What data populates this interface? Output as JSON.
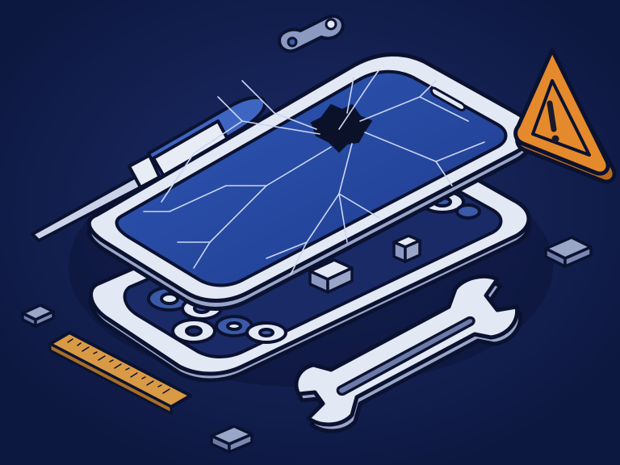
{
  "scene": {
    "subject": "broken-smartphone-repair",
    "colors": {
      "background": "#0f1b45",
      "background_glow": "#1a2a66",
      "outline": "#0b1230",
      "frame_light": "#e3e8f5",
      "frame_shadow": "#9aa6c8",
      "screen_blue": "#2a4ea8",
      "screen_blue_dark": "#1c3680",
      "crack": "#c9d6f2",
      "hole": "#0a1128",
      "internal_blue": "#3a5aa8",
      "component_gray": "#8c9ac2",
      "warning_orange": "#e58a2c",
      "warning_dark": "#1a1a2a",
      "ruler_orange": "#d99a45",
      "screwdriver_handle": "#e8ecf5",
      "screwdriver_blue": "#3f65c2"
    },
    "icons": [
      "smartphone-screen-icon",
      "smartphone-frame-icon",
      "screwdriver-icon",
      "wrench-icon",
      "warning-triangle-icon",
      "ruler-icon",
      "connector-clip-icon",
      "chip-component-icon"
    ]
  }
}
